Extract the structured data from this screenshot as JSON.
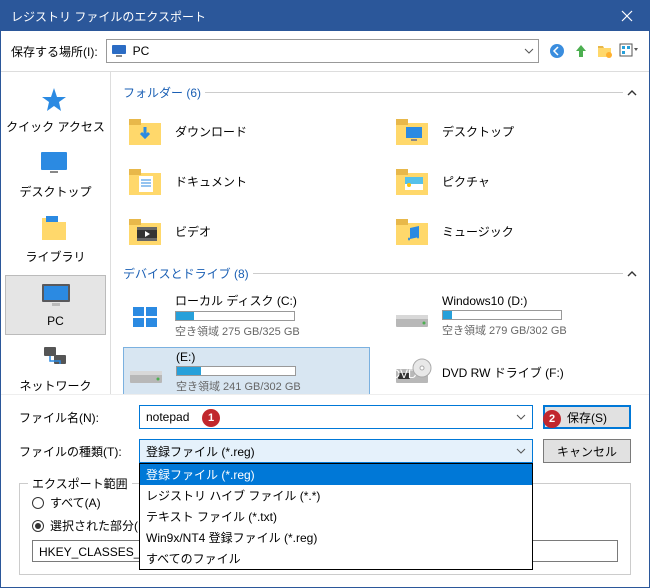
{
  "title": "レジストリ ファイルのエクスポート",
  "toolbar": {
    "saveInLabel": "保存する場所(I):",
    "location": "PC"
  },
  "sidebar": [
    {
      "label": "クイック アクセス"
    },
    {
      "label": "デスクトップ"
    },
    {
      "label": "ライブラリ"
    },
    {
      "label": "PC"
    },
    {
      "label": "ネットワーク"
    }
  ],
  "folders": {
    "header": "フォルダー (6)",
    "items": [
      "ダウンロード",
      "デスクトップ",
      "ドキュメント",
      "ピクチャ",
      "ビデオ",
      "ミュージック"
    ]
  },
  "drives": {
    "header": "デバイスとドライブ (8)",
    "items": [
      {
        "name": "ローカル ディスク (C:)",
        "sub": "空き領域 275 GB/325 GB",
        "fill": 15
      },
      {
        "name": "Windows10 (D:)",
        "sub": "空き領域 279 GB/302 GB",
        "fill": 8
      },
      {
        "name": "(E:)",
        "sub": "空き領域 241 GB/302 GB",
        "fill": 20
      },
      {
        "name": "DVD RW ドライブ (F:)",
        "sub": "",
        "fill": null
      }
    ]
  },
  "fileNameLabel": "ファイル名(N):",
  "fileName": "notepad",
  "fileTypeLabel": "ファイルの種類(T):",
  "fileTypeSelected": "登録ファイル (*.reg)",
  "fileTypes": [
    "登録ファイル (*.reg)",
    "レジストリ ハイブ ファイル (*.*)",
    "テキスト ファイル (*.txt)",
    "Win9x/NT4 登録ファイル (*.reg)",
    "すべてのファイル"
  ],
  "saveBtn": "保存(S)",
  "cancelBtn": "キャンセル",
  "export": {
    "legend": "エクスポート範囲",
    "all": "すべて(A)",
    "selected": "選択された部分(E)",
    "path": "HKEY_CLASSES_ROOT¥*¥shell¥メモ帳で開く"
  },
  "badges": {
    "one": "1",
    "two": "2"
  }
}
